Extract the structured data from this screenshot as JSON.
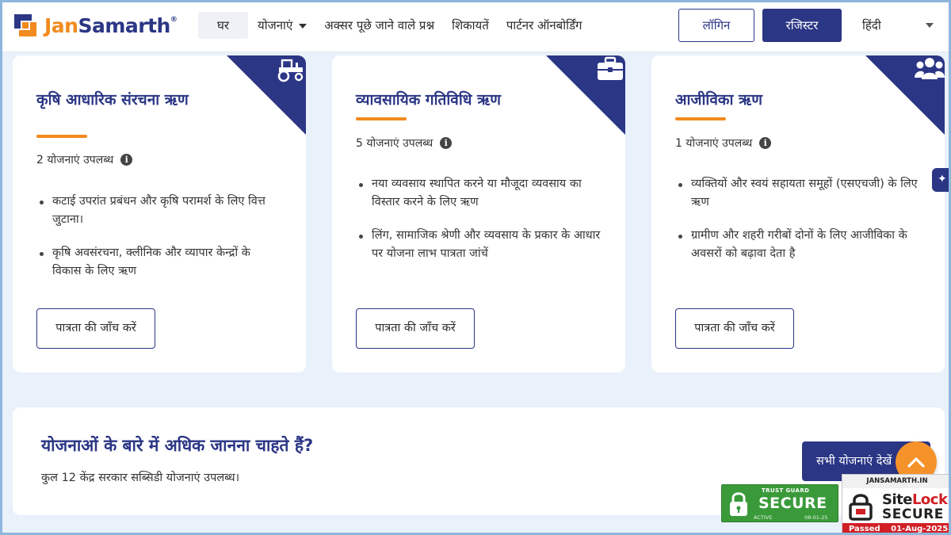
{
  "brand": {
    "name_part1": "Jan",
    "name_part2": "Samarth",
    "trademark": "®"
  },
  "nav": {
    "home": "घर",
    "schemes": "योजनाएं",
    "faq": "अक्सर पूछे जाने वाले प्रश्न",
    "complaints": "शिकायतें",
    "partner_onboarding": "पार्टनर ऑनबोर्डिंग",
    "login": "लॉगिन",
    "register": "रजिस्टर",
    "language": "हिंदी"
  },
  "colors": {
    "primary": "#2b3685",
    "accent": "#f28a1d",
    "page_bg": "#e9f1fb"
  },
  "cards": [
    {
      "title": "कृषि आधारिक संरचना ऋण",
      "icon": "tractor-icon",
      "count_text": "2 योजनाएं उपलब्ध",
      "bullets": [
        "कटाई उपरांत प्रबंधन और कृषि परामर्श के लिए वित्त जुटाना।",
        "कृषि अवसंरचना, क्लीनिक और व्यापार केन्द्रों के विकास के लिए ऋण"
      ],
      "button": "पात्रता की जाँच करें"
    },
    {
      "title": "व्यावसायिक गतिविधि ऋण",
      "icon": "briefcase-icon",
      "count_text": "5 योजनाएं उपलब्ध",
      "bullets": [
        "नया व्यवसाय स्थापित करने या मौजूदा व्यवसाय का विस्तार करने के लिए ऋण",
        "लिंग, सामाजिक श्रेणी और व्यवसाय के प्रकार के आधार पर योजना लाभ पात्रता जांचें"
      ],
      "button": "पात्रता की जाँच करें"
    },
    {
      "title": "आजीविका ऋण",
      "icon": "people-group-icon",
      "count_text": "1 योजनाएं उपलब्ध",
      "bullets": [
        "व्यक्तियों और स्वयं सहायता समूहों (एसएचजी) के लिए ऋण",
        "ग्रामीण और शहरी गरीबों दोनों के लिए आजीविका के अवसरों को बढ़ावा देता है"
      ],
      "button": "पात्रता की जाँच करें"
    }
  ],
  "more": {
    "title": "योजनाओं के बारे में अधिक जानना चाहते हैं?",
    "subtitle": "कुल 12 केंद्र सरकार सब्सिडी योजनाएं उपलब्ध।",
    "button": "सभी योजनाएं देखें"
  },
  "seals": {
    "trustguard_top": "TRUST GUARD",
    "trustguard_main": "SECURE",
    "trustguard_status": "ACTIVE",
    "trustguard_date": "08-01-25",
    "sitelock_domain": "JANSAMARTH.IN",
    "sitelock_name_part1": "Site",
    "sitelock_name_part2": "Lock",
    "sitelock_secure": "SECURE",
    "sitelock_passed": "Passed",
    "sitelock_date": "01-Aug-2025"
  }
}
